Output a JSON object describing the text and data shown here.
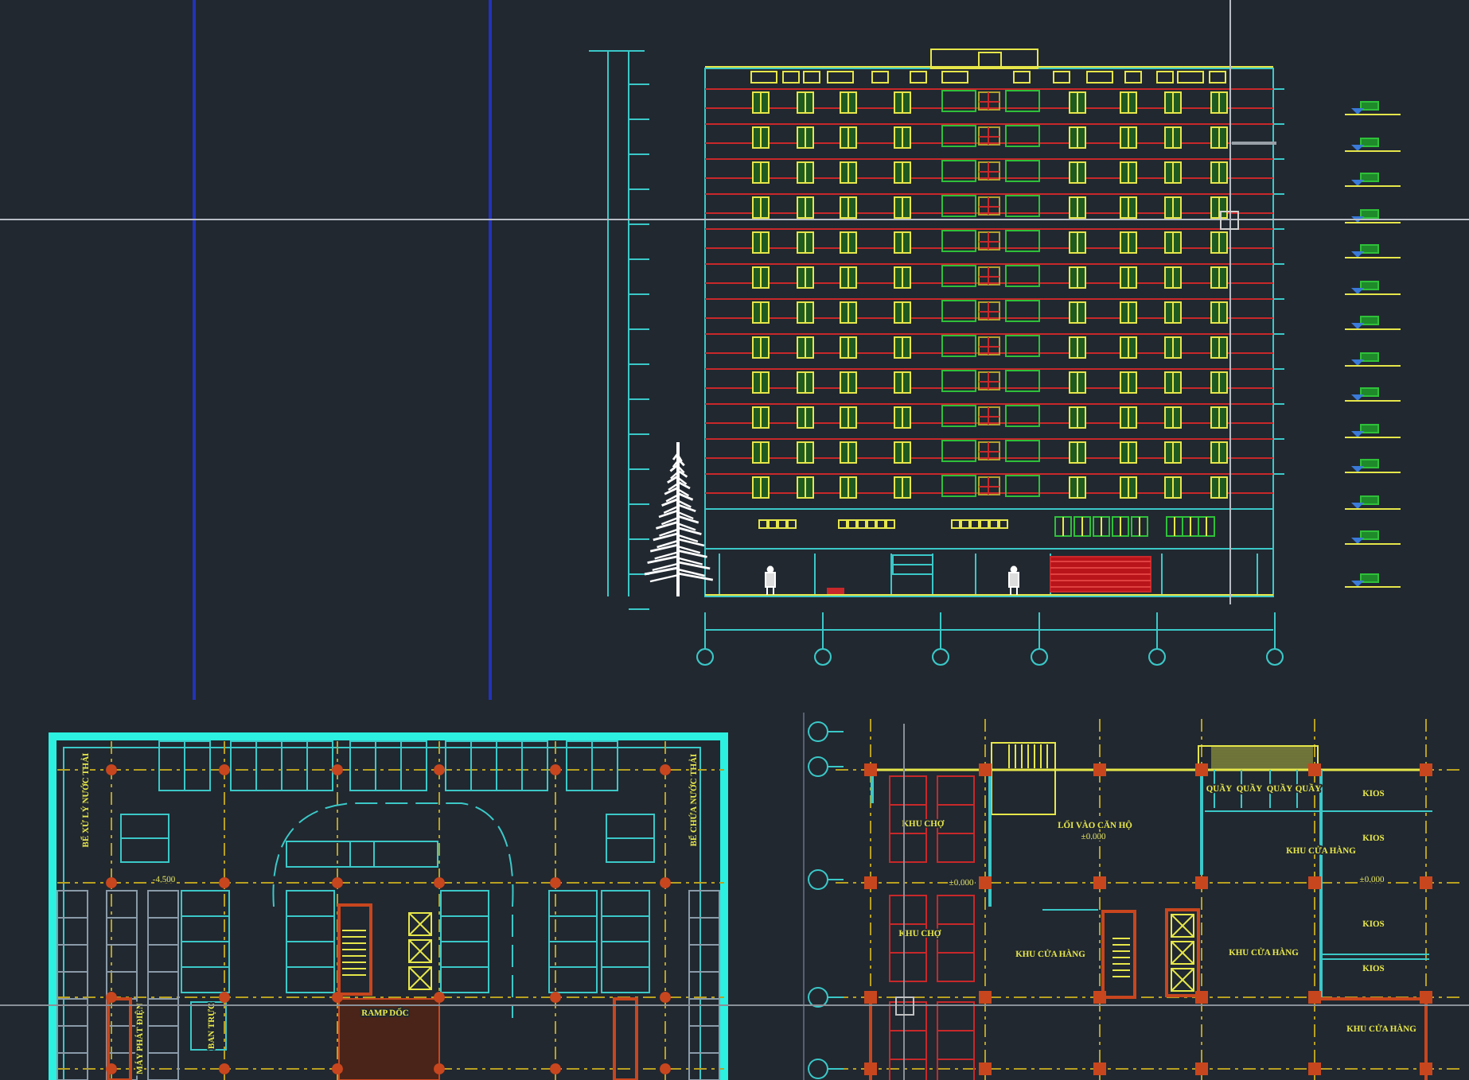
{
  "basement_plan": {
    "labels": [
      {
        "text": "BỂ XỬ LÝ NƯỚC THẢI",
        "kind": "vertical"
      },
      {
        "text": "BỂ CHỨA NƯỚC THẢI",
        "kind": "vertical"
      },
      {
        "text": "-4.500",
        "kind": "level"
      },
      {
        "text": "MÁY PHÁT ĐIỆN",
        "kind": "vertical"
      },
      {
        "text": "BAN TRỰC",
        "kind": "vertical"
      },
      {
        "text": "RAMP DỐC",
        "kind": "room"
      }
    ]
  },
  "ground_floor_plan": {
    "labels": [
      {
        "text": "KHU CHỢ",
        "kind": "room"
      },
      {
        "text": "KHU CHỢ",
        "kind": "room"
      },
      {
        "text": "LỐI VÀO CĂN HỘ",
        "kind": "room"
      },
      {
        "text": "±0.000",
        "kind": "level"
      },
      {
        "text": "QUẦY",
        "kind": "room"
      },
      {
        "text": "QUẦY",
        "kind": "room"
      },
      {
        "text": "QUẦY",
        "kind": "room"
      },
      {
        "text": "QUẦY",
        "kind": "room"
      },
      {
        "text": "KIOS",
        "kind": "room"
      },
      {
        "text": "KIOS",
        "kind": "room"
      },
      {
        "text": "KHU CỬA HÀNG",
        "kind": "room"
      },
      {
        "text": "±0.000",
        "kind": "level"
      },
      {
        "text": "±0.000",
        "kind": "level"
      },
      {
        "text": "KHU CỬA HÀNG",
        "kind": "room"
      },
      {
        "text": "KHU CỬA HÀNG",
        "kind": "room"
      },
      {
        "text": "KIOS",
        "kind": "room"
      },
      {
        "text": "KIOS",
        "kind": "room"
      },
      {
        "text": "KHU CỬA HÀNG",
        "kind": "room"
      }
    ]
  }
}
